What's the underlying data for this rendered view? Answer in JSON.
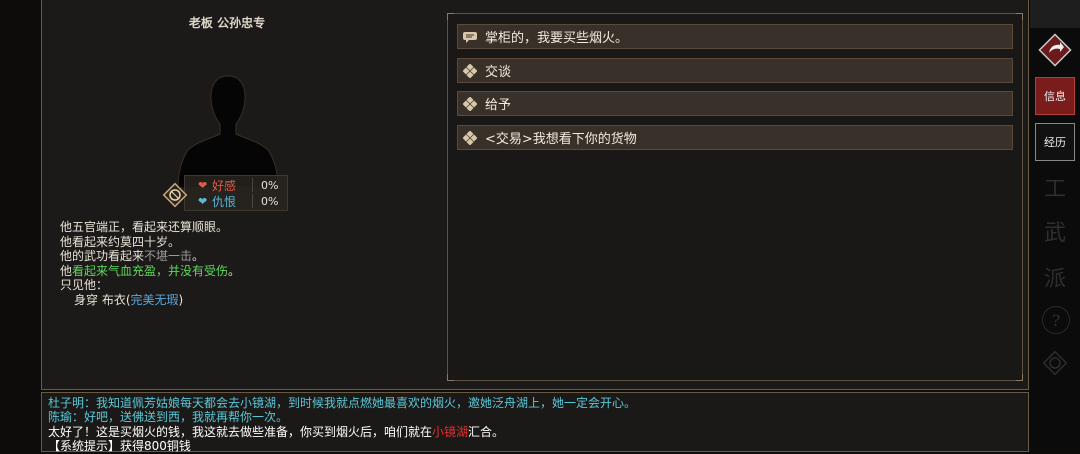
{
  "npc": {
    "title": "老板  公孙忠专",
    "favor_label": "好感",
    "favor_value": "0%",
    "hatred_label": "仇恨",
    "hatred_value": "0%"
  },
  "description": {
    "line1": "他五官端正，看起来还算顺眼。",
    "line2": "他看起来约莫四十岁。",
    "line3_prefix": "他的武功看起来",
    "line3_highlight": "不堪一击",
    "line3_suffix": "。",
    "line4_prefix": "他",
    "line4_highlight": "看起来气血充盈，并没有受伤",
    "line4_suffix": "。",
    "line5": "只见他：",
    "line6_prefix": "身穿 布衣(",
    "line6_highlight": "完美无瑕",
    "line6_suffix": ")"
  },
  "dialog_options": [
    {
      "label": "掌柜的，我要买些烟火。",
      "icon": "speech-bubble-icon"
    },
    {
      "label": "交谈",
      "icon": "diamond-icon"
    },
    {
      "label": "给予",
      "icon": "diamond-icon"
    },
    {
      "label": "<交易>我想看下你的货物",
      "icon": "diamond-icon"
    }
  ],
  "right_nav": {
    "info": "信息",
    "experience": "经历",
    "ghost1": "工",
    "ghost2": "武",
    "ghost3": "派",
    "ghost4": "?"
  },
  "log": {
    "line1": "杜子明：我知道佩芳姑娘每天都会去小镜湖，到时候我就点燃她最喜欢的烟火，邀她泛舟湖上，她一定会开心。",
    "line2": "陈瑜：好吧，送佛送到西，我就再帮你一次。",
    "line3_prefix": "太好了！这是买烟火的钱，我这就去做些准备，你买到烟火后，咱们就在",
    "line3_highlight": "小镜湖",
    "line3_suffix": "汇合。",
    "line4": "【系统提示】获得800铜钱"
  },
  "colors": {
    "favor": "#e05a4a",
    "hatred": "#5ab8d8",
    "grey_text": "#9a9a9a",
    "green_text": "#5cd85c",
    "blue_text": "#5aa8e0",
    "log_cyan": "#5ac8d8",
    "log_red": "#e03030",
    "nav_active": "#7a1c1c"
  }
}
